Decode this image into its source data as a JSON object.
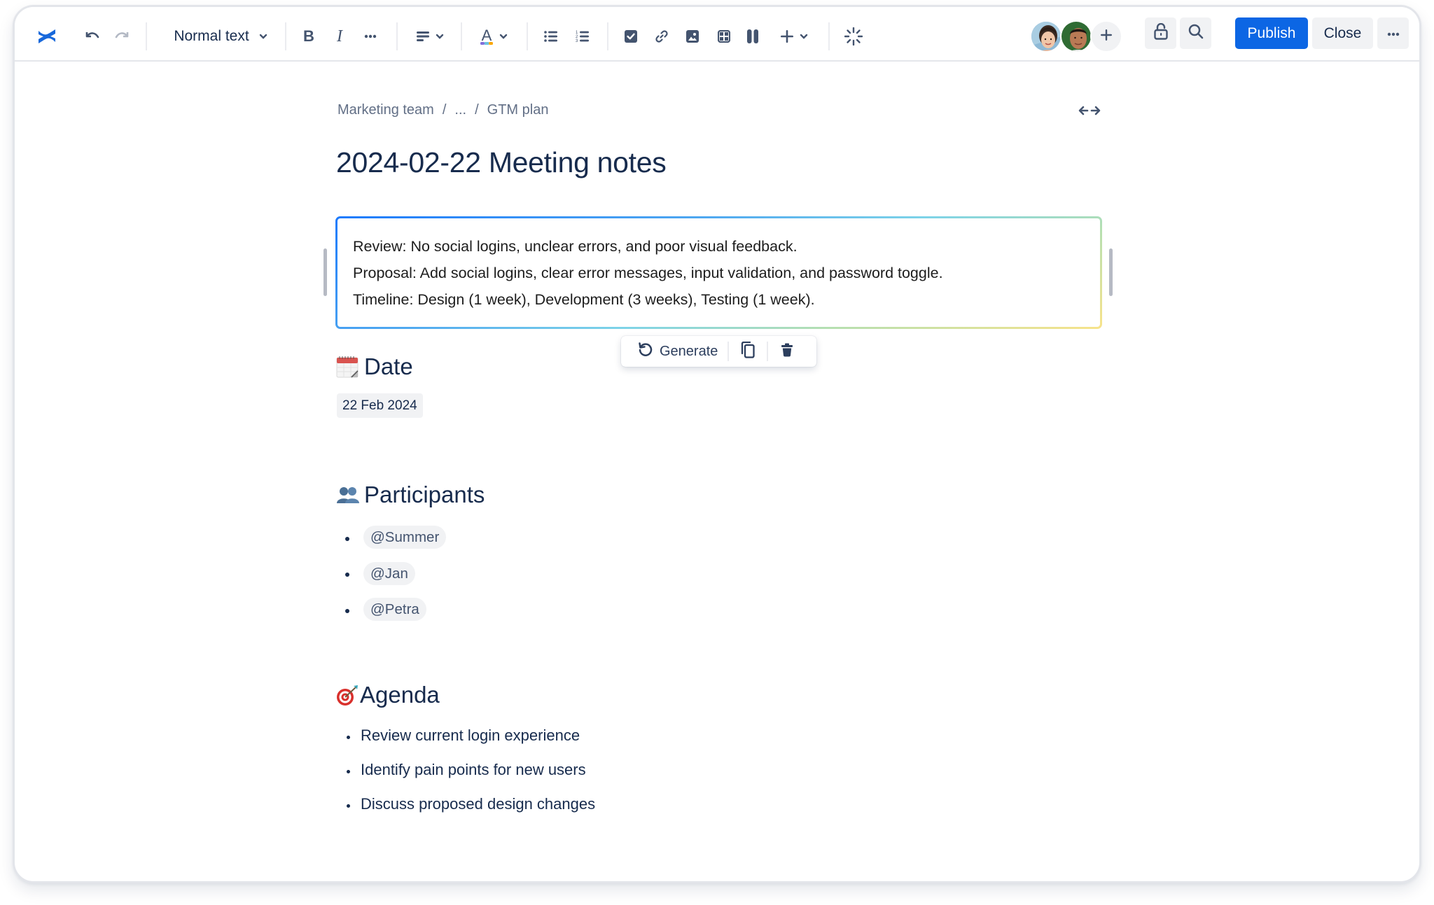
{
  "toolbar": {
    "logo": "confluence-logo-icon",
    "undo": "undo-icon",
    "redo": "redo-icon",
    "text_style": "Normal text",
    "bold": "bold-icon",
    "italic": "italic-icon",
    "more_formatting": "more-formatting-icon",
    "alignment": "align-left-icon",
    "text_color": "text-color-icon",
    "bullet_list": "bullet-list-icon",
    "numbered_list": "numbered-list-icon",
    "action_item": "task-checkbox-icon",
    "link": "link-icon",
    "image": "image-icon",
    "table": "table-icon",
    "layouts": "columns-icon",
    "insert": "plus-icon",
    "ai": "atlassian-intelligence-icon",
    "collaborators": [
      {
        "name": "collaborator-woman"
      },
      {
        "name": "collaborator-man"
      }
    ],
    "invite": "add-collaborator-icon",
    "restrictions": "unlock-icon",
    "find": "search-icon",
    "publish_label": "Publish",
    "close_label": "Close",
    "more": "more-actions-icon",
    "accent_color": "#0C66E4"
  },
  "breadcrumb": {
    "items": [
      "Marketing team",
      "...",
      "GTM plan"
    ],
    "separator": "/"
  },
  "page": {
    "title": "2024-02-22 Meeting notes"
  },
  "ai_summary": {
    "lines": [
      "Review: No social logins, unclear errors, and poor visual feedback.",
      "Proposal: Add social logins, clear error messages, input validation, and password toggle.",
      "Timeline: Design (1 week), Development (3 weeks), Testing (1 week)."
    ],
    "actions": {
      "generate_label": "Generate",
      "copy": "copy-icon",
      "delete": "trash-icon"
    }
  },
  "sections": {
    "date": {
      "emoji": "calendar-emoji",
      "heading": "Date",
      "value": "22 Feb 2024"
    },
    "participants": {
      "emoji": "busts-in-silhouette-emoji",
      "heading": "Participants",
      "mentions": [
        "@Summer",
        "@Jan",
        "@Petra"
      ]
    },
    "agenda": {
      "emoji": "direct-hit-emoji",
      "heading": "Agenda",
      "items": [
        "Review current login experience",
        "Identify pain points for new users",
        "Discuss proposed design changes"
      ]
    }
  }
}
